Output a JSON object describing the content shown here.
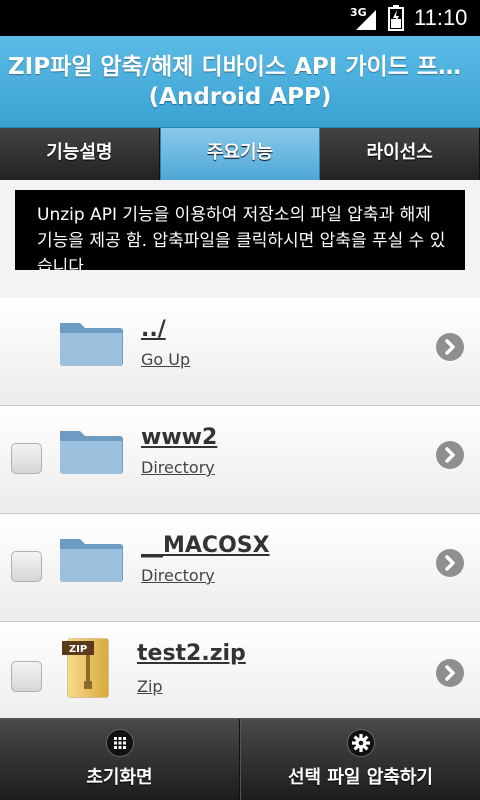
{
  "status_bar": {
    "network": "3G",
    "time": "11:10"
  },
  "header": {
    "title_line1": "ZIP파일 압축/해제 디바이스 API 가이드 프로그램",
    "title_line2": "(Android APP)"
  },
  "tabs": [
    {
      "label": "기능설명",
      "active": false
    },
    {
      "label": "주요기능",
      "active": true
    },
    {
      "label": "라이선스",
      "active": false
    }
  ],
  "description": "Unzip API 기능을 이용하여 저장소의 파일 압축과 해제 기능을 제공 함. 압축파일을 클릭하시면 압축을 푸실 수 있습니다.",
  "files": [
    {
      "name": "../",
      "type": "Go Up",
      "icon": "folder-icon",
      "checkbox": false
    },
    {
      "name": "www2",
      "type": "Directory",
      "icon": "folder-icon",
      "checkbox": true
    },
    {
      "name": "__MACOSX",
      "type": "Directory",
      "icon": "folder-icon",
      "checkbox": true
    },
    {
      "name": "test2.zip",
      "type": "Zip",
      "icon": "zip-file-icon",
      "checkbox": true,
      "icon_label": "ZIP"
    }
  ],
  "footer": {
    "home_label": "초기화면",
    "home_icon": "grid-icon",
    "compress_label": "선택 파일 압축하기",
    "compress_icon": "gear-icon"
  },
  "colors": {
    "header": "#3aa2d3",
    "tab_active": "#4ea8d7",
    "tab_inactive": "#333333"
  }
}
